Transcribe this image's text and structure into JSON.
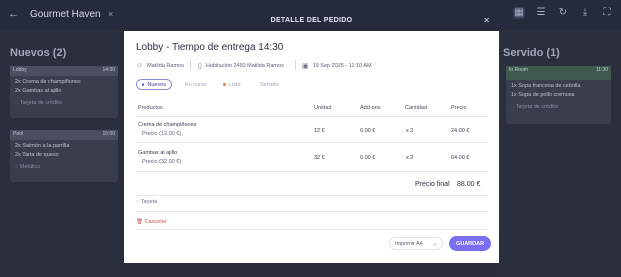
{
  "app": {
    "title": "Gourmet Haven",
    "tab_close": "×"
  },
  "icons": {
    "back": "arrow-left-icon",
    "grid": "grid-icon",
    "list": "list-icon",
    "refresh": "refresh-icon",
    "download": "download-icon",
    "fullscreen": "fullscreen-icon",
    "close": "close-icon",
    "person": "person-icon",
    "room": "room-icon",
    "calendar": "calendar-icon",
    "card": "card-icon",
    "trash": "trash-icon",
    "chevron": "chevron-down-icon"
  },
  "columns": {
    "left": {
      "title": "Nuevos (2)",
      "cards": [
        {
          "location": "Lobby",
          "time": "14:30",
          "items": [
            "2x Crema de champiñones",
            "2x Gambas al ajillo"
          ],
          "payment": "Tarjeta de crédito"
        },
        {
          "location": "Pool",
          "time": "15:00",
          "items": [
            "2x Salmón a la parrilla",
            "2x Tarta de queso"
          ],
          "payment": "Metálico"
        }
      ]
    },
    "right": {
      "title": "Servido (1)",
      "cards": [
        {
          "location": "In Room",
          "time": "11:30",
          "items": [
            "1x Sopa francesa de cebolla",
            "1x Sopa de pollo cremosa"
          ],
          "payment": "Tarjeta de crédito"
        }
      ]
    }
  },
  "modal": {
    "header": "DETALLE DEL PEDIDO",
    "title": "Lobby - Tiempo de entrega 14:30",
    "customer": "Matilda Ramos",
    "room": "Habitación 2450 Matilda Ramos",
    "date": "19 Sep 2025 - 11:10 AM",
    "tabs": [
      {
        "label": "Nuevos",
        "active": true,
        "dot": "#5b5fd6"
      },
      {
        "label": "En curso",
        "active": false,
        "dot": ""
      },
      {
        "label": "Listo",
        "active": false,
        "dot": "#e07a4a"
      },
      {
        "label": "Servido",
        "active": false,
        "dot": ""
      }
    ],
    "columns": [
      "Productos",
      "Unidad",
      "Add-ons",
      "Cantidad",
      "Precio"
    ],
    "rows": [
      {
        "product": "Crema de champiñones",
        "sub": "Precio (12.00 €)",
        "unit": "12 €",
        "addons": "0.00 €",
        "qty": "x 2",
        "price": "24.00 €"
      },
      {
        "product": "Gambas al ajillo",
        "sub": "Precio (32.00 €)",
        "unit": "32 €",
        "addons": "0.00 €",
        "qty": "x 2",
        "price": "64.00 €"
      }
    ],
    "total_label": "Precio final",
    "total_value": "88.00 €",
    "payment": "Tarjeta",
    "cancel": "Cancelar",
    "print": "Imprimir A4",
    "save": "GUARDAR"
  }
}
